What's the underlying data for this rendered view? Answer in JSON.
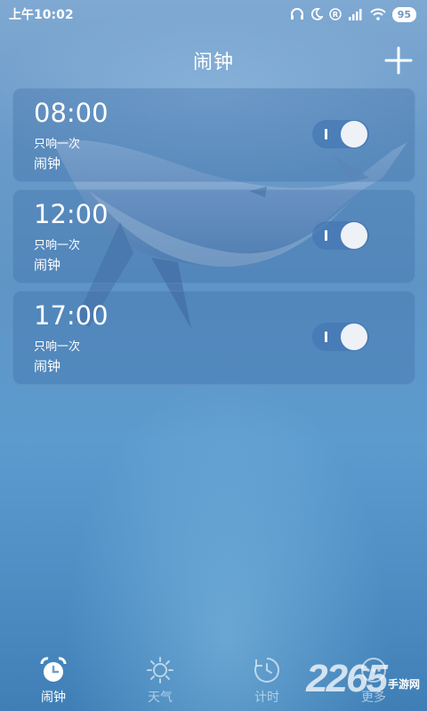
{
  "status_bar": {
    "time": "上午10:02",
    "battery": "95"
  },
  "header": {
    "title": "闹钟"
  },
  "alarms": [
    {
      "time": "08:00",
      "repeat": "只响一次",
      "label": "闹钟",
      "enabled": true
    },
    {
      "time": "12:00",
      "repeat": "只响一次",
      "label": "闹钟",
      "enabled": true
    },
    {
      "time": "17:00",
      "repeat": "只响一次",
      "label": "闹钟",
      "enabled": true
    }
  ],
  "nav": {
    "items": [
      {
        "label": "闹钟",
        "icon": "alarm-clock-icon",
        "active": true
      },
      {
        "label": "天气",
        "icon": "sun-icon",
        "active": false
      },
      {
        "label": "计时",
        "icon": "timer-icon",
        "active": false
      },
      {
        "label": "更多",
        "icon": "more-icon",
        "active": false
      }
    ]
  },
  "watermark": {
    "number": "2265",
    "text": "手游网"
  }
}
